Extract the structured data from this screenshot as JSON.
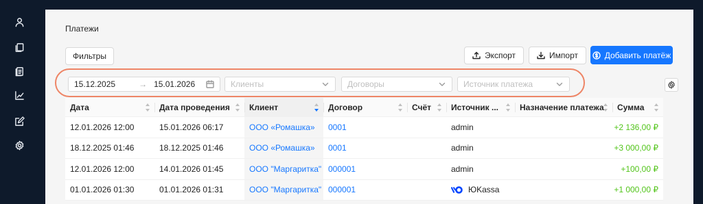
{
  "sidebar": {
    "icons": [
      "user-icon",
      "copy-icon",
      "documents-icon",
      "chart-icon",
      "edit-icon",
      "settings-icon"
    ]
  },
  "page": {
    "title": "Платежи"
  },
  "toolbar": {
    "filters_label": "Фильтры",
    "export_label": "Экспорт",
    "import_label": "Импорт",
    "add_payment_label": "Добавить платёж"
  },
  "filters": {
    "date_from": "15.12.2025",
    "date_arrow": "→",
    "date_to": "15.01.2026",
    "clients_placeholder": "Клиенты",
    "contracts_placeholder": "Договоры",
    "source_placeholder": "Источник платежа"
  },
  "table": {
    "columns": [
      "Дата",
      "Дата проведения",
      "Клиент",
      "Договор",
      "Счёт",
      "Источник ...",
      "Назначение платежа",
      "Сумма"
    ],
    "rows": [
      {
        "date": "12.01.2026 12:00",
        "posted": "15.01.2026 06:17",
        "client": "ООО «Ромашка»",
        "contract": "0001",
        "invoice": "",
        "source": "admin",
        "purpose": "",
        "amount": "+2 136,00 ₽"
      },
      {
        "date": "18.12.2025 01:46",
        "posted": "18.12.2025 01:46",
        "client": "ООО «Ромашка»",
        "contract": "0001",
        "invoice": "",
        "source": "admin",
        "purpose": "",
        "amount": "+3 000,00 ₽"
      },
      {
        "date": "12.01.2026 12:00",
        "posted": "14.01.2026 01:45",
        "client": "ООО \"Маргаритка\"",
        "contract": "000001",
        "invoice": "",
        "source": "admin",
        "purpose": "",
        "amount": "+100,00 ₽"
      },
      {
        "date": "01.01.2026 01:30",
        "posted": "01.01.2026 01:31",
        "client": "ООО \"Маргаритка\"",
        "contract": "000001",
        "invoice": "",
        "source": "ЮKassa",
        "purpose": "",
        "amount": "+1 000,00 ₽"
      }
    ]
  },
  "colors": {
    "primary": "#1677ff",
    "amount_positive": "#52c41a",
    "highlight_outline": "#ee8566",
    "sidebar_bg": "#0e1a2b"
  }
}
